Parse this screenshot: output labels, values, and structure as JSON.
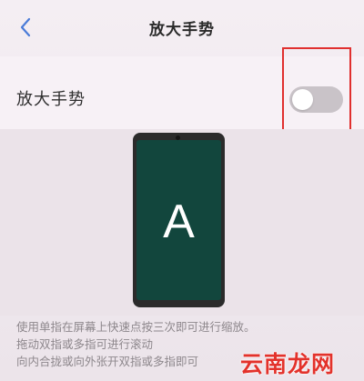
{
  "header": {
    "title": "放大手势",
    "back_icon": "chevron-left-icon",
    "back_color": "#4a7bd8"
  },
  "setting": {
    "label": "放大手势",
    "toggle_state": "off"
  },
  "demo": {
    "letter": "A",
    "screen_color": "#12463d"
  },
  "description": {
    "lines": [
      "使用单指在屏幕上快速点按三次即可进行缩放。",
      "拖动双指或多指可进行滚动",
      "向内合拢或向外张开双指或多指即可"
    ]
  },
  "watermark": {
    "text": "云南龙网"
  },
  "colors": {
    "highlight": "#e0302f",
    "toggle_off": "#c9c3c8"
  }
}
